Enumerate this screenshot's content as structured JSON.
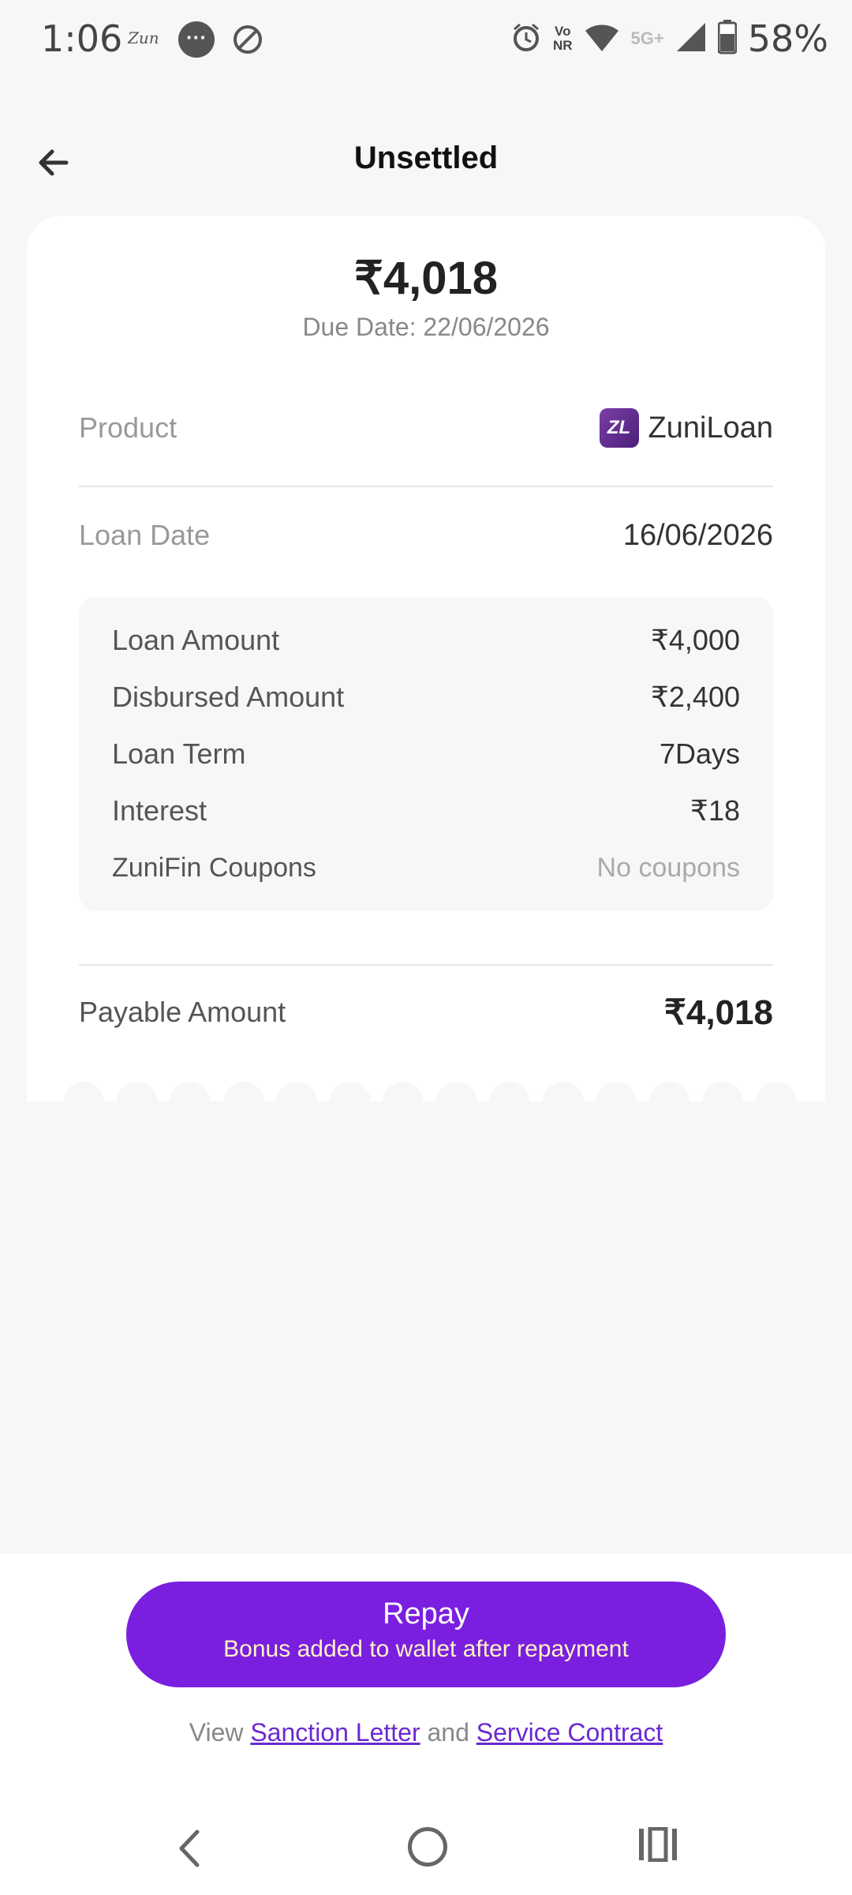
{
  "status_bar": {
    "time": "1:06",
    "carrier_label": "Zun",
    "message_icon": "message-icon",
    "battery_percent": "58%",
    "network_label": "5G+",
    "vonr_top": "Vo",
    "vonr_bottom": "NR"
  },
  "header": {
    "title": "Unsettled",
    "back_icon": "arrow-left-icon"
  },
  "summary": {
    "amount": "₹4,018",
    "due_date": "Due Date: 22/06/2026"
  },
  "product": {
    "label": "Product",
    "logo_text": "ZL",
    "name": "ZuniLoan"
  },
  "loan_date": {
    "label": "Loan Date",
    "value": "16/06/2026"
  },
  "details": [
    {
      "label": "Loan Amount",
      "value": "₹4,000"
    },
    {
      "label": "Disbursed Amount",
      "value": "₹2,400"
    },
    {
      "label": "Loan Term",
      "value": "7Days"
    },
    {
      "label": "Interest",
      "value": "₹18"
    },
    {
      "label": "ZuniFin Coupons",
      "value": "No coupons"
    }
  ],
  "payable": {
    "label": "Payable Amount",
    "value": "₹4,018"
  },
  "repay": {
    "title": "Repay",
    "subtitle": "Bonus added to wallet after repayment"
  },
  "links": {
    "prefix": "View",
    "sanction": "Sanction Letter",
    "and": "and",
    "contract": "Service Contract"
  },
  "colors": {
    "accent": "#7a1fe0",
    "background": "#f6f7f9"
  }
}
